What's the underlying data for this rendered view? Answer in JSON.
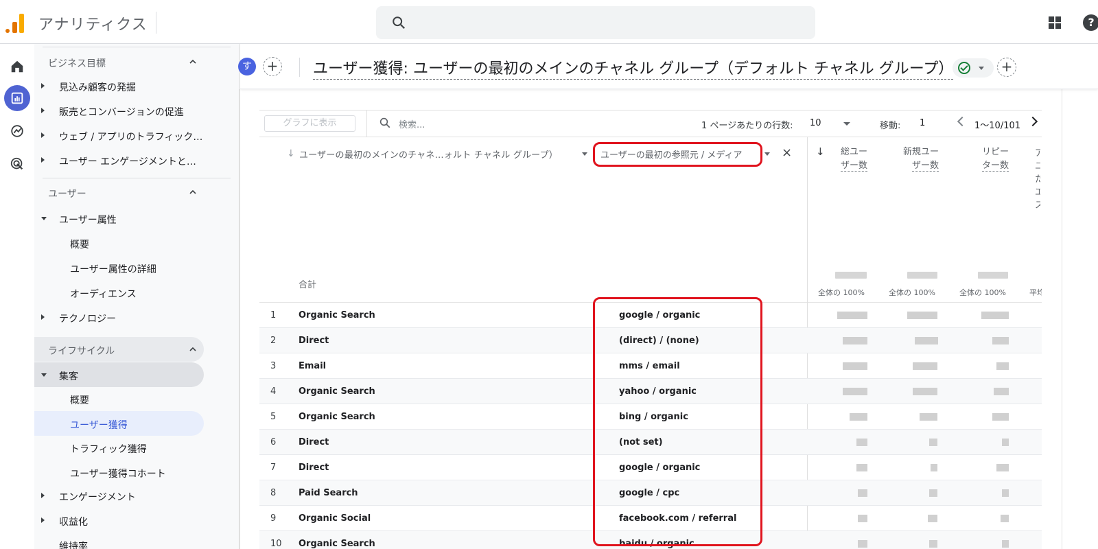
{
  "app": {
    "title": "アナリティクス"
  },
  "header": {
    "search_placeholder": ""
  },
  "sidebar": {
    "sec_business": "ビジネス目標",
    "business_items": [
      "見込み顧客の発掘",
      "販売とコンバージョンの促進",
      "ウェブ / アプリのトラフィック…",
      "ユーザー エンゲージメントと…"
    ],
    "sec_user": "ユーザー",
    "user_attr": "ユーザー属性",
    "user_attr_sub": [
      "概要",
      "ユーザー属性の詳細",
      "オーディエンス"
    ],
    "technology": "テクノロジー",
    "sec_lifecycle": "ライフサイクル",
    "acquisition": "集客",
    "acquisition_sub": [
      "概要",
      "ユーザー獲得",
      "トラフィック獲得",
      "ユーザー獲得コホート"
    ],
    "engagement": "エンゲージメント",
    "monetization": "収益化",
    "retention": "維持率"
  },
  "report": {
    "avatar": "す",
    "add": "+",
    "title": "ユーザー獲得: ユーザーの最初のメインのチャネル グループ（デフォルト チャネル グループ）"
  },
  "table": {
    "graph_button": "グラフに表示",
    "search_placeholder": "検索...",
    "rows_per_page_label": "1 ページあたりの行数:",
    "rows_per_page": "10",
    "goto_label": "移動:",
    "goto_value": "1",
    "page_range": "1〜10/101",
    "dim1": "ユーザーの最初のメインのチャネ…ォルト チャネル グループ）",
    "dim2": "ユーザーの最初の参照元 / メディア",
    "close": "×",
    "sort_arrow": "↓",
    "metrics": [
      {
        "l1": "総ユー",
        "l2": "ザー数"
      },
      {
        "l1": "新規ユー",
        "l2": "ザー数"
      },
      {
        "l1": "リピー",
        "l2": "ター数"
      }
    ],
    "total_label": "合計",
    "pct_labels": [
      "全体の 100%",
      "全体の 100%",
      "全体の 100%",
      "平均"
    ],
    "rows": [
      {
        "n": "1",
        "channel": "Organic Search",
        "source": "google / organic"
      },
      {
        "n": "2",
        "channel": "Direct",
        "source": "(direct) / (none)"
      },
      {
        "n": "3",
        "channel": "Email",
        "source": "mms / email"
      },
      {
        "n": "4",
        "channel": "Organic Search",
        "source": "yahoo / organic"
      },
      {
        "n": "5",
        "channel": "Organic Search",
        "source": "bing / organic"
      },
      {
        "n": "6",
        "channel": "Direct",
        "source": "(not set)"
      },
      {
        "n": "7",
        "channel": "Direct",
        "source": "google / organic"
      },
      {
        "n": "8",
        "channel": "Paid Search",
        "source": "google / cpc"
      },
      {
        "n": "9",
        "channel": "Organic Social",
        "source": "facebook.com / referral"
      },
      {
        "n": "10",
        "channel": "Organic Search",
        "source": "baidu / organic"
      }
    ]
  },
  "colors": {
    "highlight": "#e0141e",
    "accent": "#4a63e0"
  }
}
